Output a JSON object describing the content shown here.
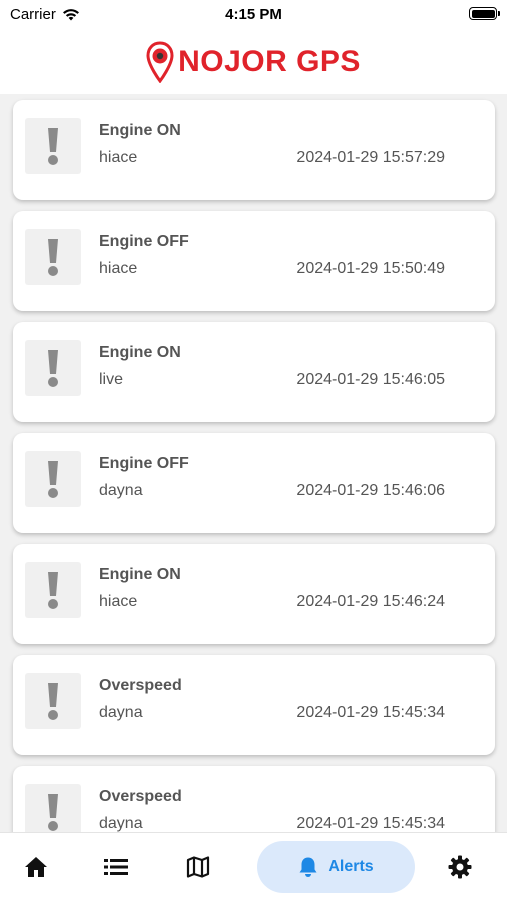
{
  "status_bar": {
    "carrier": "Carrier",
    "time": "4:15 PM"
  },
  "header": {
    "brand": "NOJOR GPS"
  },
  "alerts": [
    {
      "title": "Engine ON",
      "device": "hiace",
      "timestamp": "2024-01-29 15:57:29"
    },
    {
      "title": "Engine OFF",
      "device": "hiace",
      "timestamp": "2024-01-29 15:50:49"
    },
    {
      "title": "Engine ON",
      "device": "live",
      "timestamp": "2024-01-29 15:46:05"
    },
    {
      "title": "Engine OFF",
      "device": "dayna",
      "timestamp": "2024-01-29 15:46:06"
    },
    {
      "title": "Engine ON",
      "device": "hiace",
      "timestamp": "2024-01-29 15:46:24"
    },
    {
      "title": "Overspeed",
      "device": "dayna",
      "timestamp": "2024-01-29 15:45:34"
    },
    {
      "title": "Overspeed",
      "device": "dayna",
      "timestamp": "2024-01-29 15:45:34"
    }
  ],
  "tabbar": {
    "home_icon": "home-icon",
    "list_icon": "list-icon",
    "map_icon": "map-icon",
    "alerts_icon": "bell-icon",
    "alerts_label": "Alerts",
    "settings_icon": "gear-icon",
    "active_color": "#1e88e5"
  },
  "colors": {
    "brand_red": "#e0232b",
    "active_tab_bg": "#dbe9fb"
  }
}
